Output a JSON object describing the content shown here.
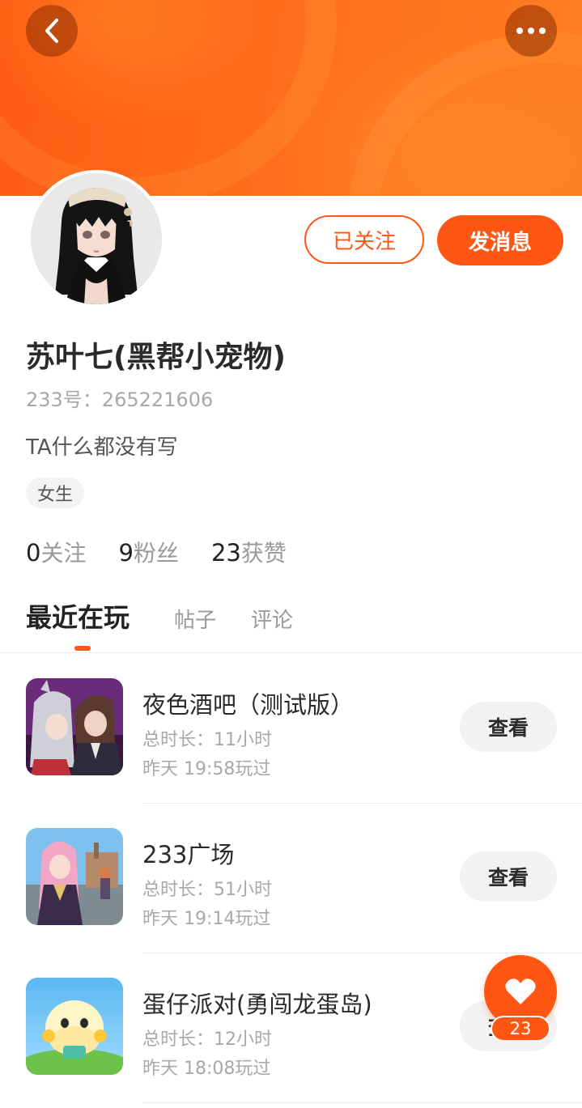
{
  "header": {
    "back_icon": "chevron-left-icon",
    "more_icon": "more-dots-icon",
    "accent_color": "#ff5614"
  },
  "profile": {
    "name": "苏叶七(黑帮小宠物)",
    "uid": "233号：265221606",
    "bio": "TA什么都没有写",
    "gender": "女生",
    "follow_button": "已关注",
    "message_button": "发消息"
  },
  "stats": [
    {
      "num": "0",
      "label": "关注"
    },
    {
      "num": "9",
      "label": "粉丝"
    },
    {
      "num": "23",
      "label": "获赞"
    }
  ],
  "tabs": [
    "最近在玩",
    "帖子",
    "评论"
  ],
  "games": [
    {
      "title": "夜色酒吧（测试版）",
      "duration": "总时长：11小时",
      "last_played": "昨天 19:58玩过",
      "button": "查看"
    },
    {
      "title": "233广场",
      "duration": "总时长：51小时",
      "last_played": "昨天 19:14玩过",
      "button": "查看"
    },
    {
      "title": "蛋仔派对(勇闯龙蛋岛)",
      "duration": "总时长：12小时",
      "last_played": "昨天 18:08玩过",
      "button": "查看"
    }
  ],
  "like": {
    "icon": "heart-icon",
    "count": "23"
  }
}
